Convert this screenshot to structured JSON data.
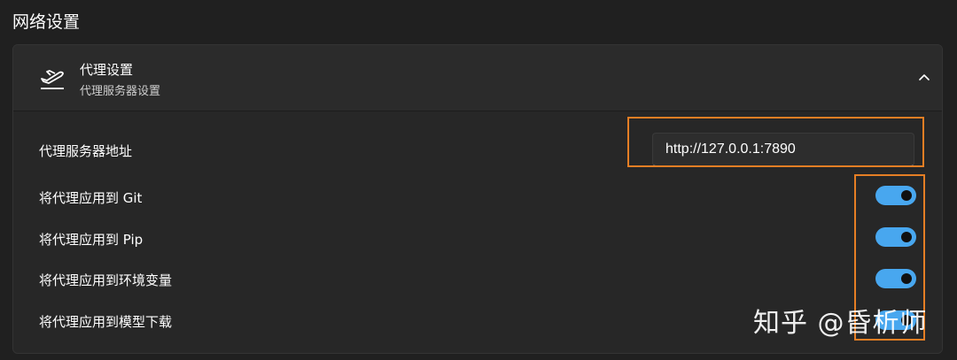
{
  "section": {
    "title": "网络设置"
  },
  "proxy_card": {
    "icon": "airplane-takeoff-icon",
    "title": "代理设置",
    "subtitle": "代理服务器设置",
    "expanded": true,
    "collapse_icon": "chevron-up-icon"
  },
  "settings": {
    "server_address": {
      "label": "代理服务器地址",
      "value": "http://127.0.0.1:7890"
    },
    "toggles": [
      {
        "label": "将代理应用到 Git",
        "on": true
      },
      {
        "label": "将代理应用到 Pip",
        "on": true
      },
      {
        "label": "将代理应用到环境变量",
        "on": true
      },
      {
        "label": "将代理应用到模型下载",
        "on": true
      }
    ]
  },
  "watermark": {
    "text": "知乎 @昏析师"
  },
  "colors": {
    "background": "#202020",
    "card": "#2a2a2a",
    "toggle_on": "#48a7ef",
    "highlight": "#e57e24"
  }
}
